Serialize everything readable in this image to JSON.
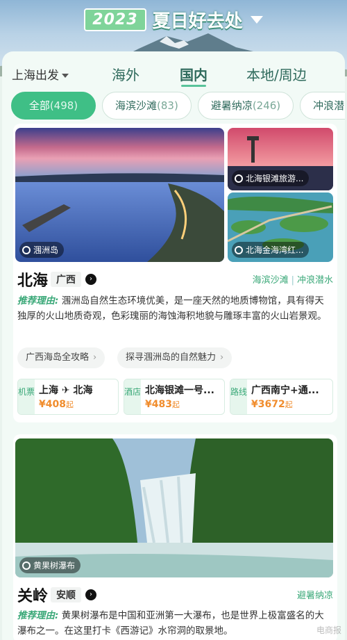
{
  "hero": {
    "year": "2023",
    "title": "夏日好去处"
  },
  "nav": {
    "origin": "上海出发",
    "tabs": [
      {
        "label": "海外"
      },
      {
        "label": "国内",
        "active": true
      },
      {
        "label": "本地/周边"
      }
    ]
  },
  "filters": [
    {
      "label": "全部",
      "count": "(498)",
      "active": true
    },
    {
      "label": "海滨沙滩",
      "count": "(83)"
    },
    {
      "label": "避暑纳凉",
      "count": "(246)"
    },
    {
      "label": "冲浪潜",
      "count": ""
    }
  ],
  "cards": [
    {
      "main_image_caption": "涠洲岛",
      "side_images": [
        {
          "caption": "北海银滩旅游..."
        },
        {
          "caption": "北海金海湾红..."
        }
      ],
      "city": "北海",
      "province": "广西",
      "tags": [
        "海滨沙滩",
        "冲浪潜水"
      ],
      "reason_label": "推荐理由:",
      "reason_text": "涠洲岛自然生态环境优美，是一座天然的地质博物馆，具有得天独厚的火山地质奇观，色彩瑰丽的海蚀海积地貌与雕琢丰富的火山岩景观。",
      "pills": [
        "广西海岛全攻略",
        "探寻涠洲岛的自然魅力"
      ],
      "deals": [
        {
          "kind": "机票",
          "name": "上海 ✈ 北海",
          "price": "¥408",
          "suffix": "起"
        },
        {
          "kind": "酒店",
          "name": "北海银滩一号...",
          "price": "¥483",
          "suffix": "起"
        },
        {
          "kind": "路线",
          "name": "广西南宁+通...",
          "price": "¥3672",
          "suffix": "起"
        }
      ]
    },
    {
      "main_image_caption": "黄果树瀑布",
      "city": "关岭",
      "province": "安顺",
      "tags": [
        "避暑纳凉"
      ],
      "reason_label": "推荐理由:",
      "reason_text": "黄果树瀑布是中国和亚洲第一大瀑布，也是世界上极富盛名的大瀑布之一。在这里打卡《西游记》水帘洞的取景地。"
    }
  ],
  "watermark": "电商报"
}
